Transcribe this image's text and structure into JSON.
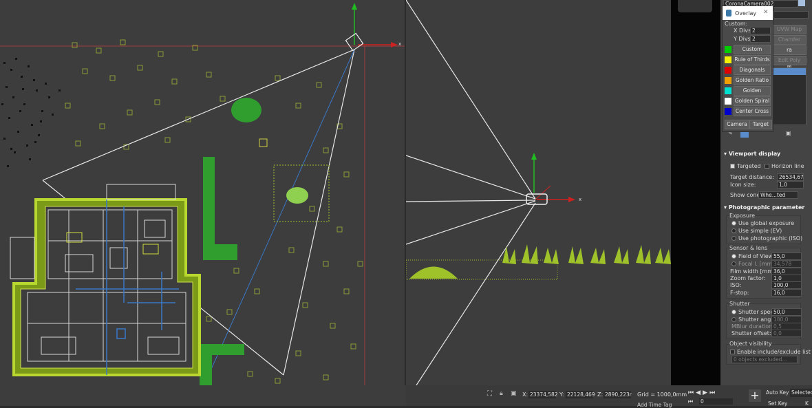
{
  "camera_name": "CoronaCamera002",
  "overlay_menu": {
    "title": "Overlay",
    "custom_label": "Custom:",
    "x_divs_label": "X Divs:",
    "x_divs_value": "2",
    "y_divs_label": "Y Divs:",
    "y_divs_value": "2",
    "items": [
      {
        "label": "Custom",
        "color": "#00cc00"
      },
      {
        "label": "Rule of Thirds",
        "color": "#f0f000"
      },
      {
        "label": "Diagonals",
        "color": "#e00000"
      },
      {
        "label": "Golden Ratio",
        "color": "#f0a000"
      },
      {
        "label": "Golden Triangle",
        "color": "#00e0d0"
      },
      {
        "label": "Golden Spiral",
        "color": "#ffffff"
      },
      {
        "label": "Center Cross",
        "color": "#0000cc"
      }
    ],
    "camera_btn": "Camera",
    "target_btn": "Target"
  },
  "modifier_list": {
    "uvw_map": "UVW Map",
    "chamfer": "Chamfer",
    "resolution": "ra Resolution M",
    "edit_poly": "Edit Poly"
  },
  "viewport_display": {
    "title": "Viewport display",
    "targeted": "Targeted",
    "horizon_line": "Horizon line",
    "target_distance_label": "Target distance:",
    "target_distance_value": "26534,67",
    "icon_size_label": "Icon size:",
    "icon_size_value": "1,0",
    "show_cone_label": "Show cone:",
    "show_cone_value": "Whe...ted"
  },
  "photographic": {
    "title": "Photographic parameter",
    "exposure_label": "Exposure",
    "use_global": "Use global exposure",
    "use_simple": "Use simple (EV)",
    "use_photographic": "Use photographic (ISO)",
    "sensor_label": "Sensor & lens",
    "fov_label": "Field of View:",
    "fov_value": "55,0",
    "focal_label": "Focal l. [mm]:",
    "focal_value": "34,578",
    "film_label": "Film width [mm]:",
    "film_value": "36,0",
    "zoom_label": "Zoom factor:",
    "zoom_value": "1,0",
    "iso_label": "ISO:",
    "iso_value": "100,0",
    "fstop_label": "F-stop:",
    "fstop_value": "16,0",
    "shutter_label": "Shutter",
    "shutter_speed_label": "Shutter speed:",
    "shutter_speed_value": "50,0",
    "shutter_angle_label": "Shutter angle:",
    "shutter_angle_value": "180,0",
    "mblur_label": "MBlur duration:",
    "mblur_value": "0,5",
    "shutter_offset_label": "Shutter offset:",
    "shutter_offset_value": "0,0",
    "visibility_label": "Object visibility",
    "enable_include": "Enable include/exclude list",
    "objects_excluded": "0 objects excluded..."
  },
  "status": {
    "x_label": "X:",
    "x_value": "23374,582",
    "y_label": "Y:",
    "y_value": "22128,469",
    "z_label": "Z:",
    "z_value": "2890,223r",
    "grid": "Grid = 1000,0mm",
    "add_time_tag": "Add Time Tag",
    "frame_value": "0",
    "auto_key": "Auto Key",
    "set_key": "Set Key",
    "selected": "Selected",
    "k": "K"
  },
  "axis_label_x": "x",
  "colors": {
    "viewport_bg": "#3d3d3d",
    "plant_green": "#2f9e2f",
    "yellow_green": "#9fc22a",
    "blueprint_blue": "#3a78c8"
  }
}
